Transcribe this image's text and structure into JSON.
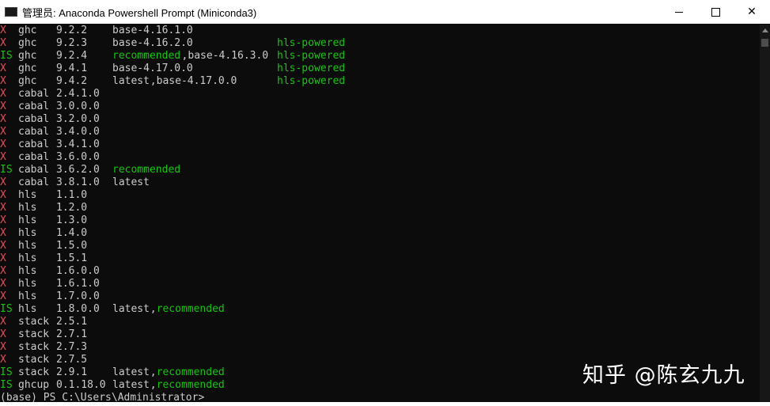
{
  "window": {
    "title": "管理员: Anaconda Powershell Prompt (Miniconda3)",
    "controls": {
      "minimize": "",
      "maximize": "",
      "close": "✕"
    }
  },
  "terminal": {
    "lines": [
      {
        "mark": "X",
        "mark_color": "red",
        "tool": "ghc",
        "version": "9.2.2",
        "tags": [
          {
            "text": "base-4.16.1.0",
            "color": "white"
          }
        ],
        "extra": ""
      },
      {
        "mark": "X",
        "mark_color": "red",
        "tool": "ghc",
        "version": "9.2.3",
        "tags": [
          {
            "text": "base-4.16.2.0",
            "color": "white"
          }
        ],
        "extra": "hls-powered"
      },
      {
        "mark": "IS",
        "mark_color": "green",
        "tool": "ghc",
        "version": "9.2.4",
        "tags": [
          {
            "text": "recommended",
            "color": "green"
          },
          {
            "text": ",",
            "color": "white"
          },
          {
            "text": "base-4.16.3.0",
            "color": "white"
          }
        ],
        "extra": "hls-powered"
      },
      {
        "mark": "X",
        "mark_color": "red",
        "tool": "ghc",
        "version": "9.4.1",
        "tags": [
          {
            "text": "base-4.17.0.0",
            "color": "white"
          }
        ],
        "extra": "hls-powered"
      },
      {
        "mark": "X",
        "mark_color": "red",
        "tool": "ghc",
        "version": "9.4.2",
        "tags": [
          {
            "text": "latest",
            "color": "white"
          },
          {
            "text": ",",
            "color": "white"
          },
          {
            "text": "base-4.17.0.0",
            "color": "white"
          }
        ],
        "extra": "hls-powered"
      },
      {
        "mark": "X",
        "mark_color": "red",
        "tool": "cabal",
        "version": "2.4.1.0",
        "tags": [],
        "extra": ""
      },
      {
        "mark": "X",
        "mark_color": "red",
        "tool": "cabal",
        "version": "3.0.0.0",
        "tags": [],
        "extra": ""
      },
      {
        "mark": "X",
        "mark_color": "red",
        "tool": "cabal",
        "version": "3.2.0.0",
        "tags": [],
        "extra": ""
      },
      {
        "mark": "X",
        "mark_color": "red",
        "tool": "cabal",
        "version": "3.4.0.0",
        "tags": [],
        "extra": ""
      },
      {
        "mark": "X",
        "mark_color": "red",
        "tool": "cabal",
        "version": "3.4.1.0",
        "tags": [],
        "extra": ""
      },
      {
        "mark": "X",
        "mark_color": "red",
        "tool": "cabal",
        "version": "3.6.0.0",
        "tags": [],
        "extra": ""
      },
      {
        "mark": "IS",
        "mark_color": "green",
        "tool": "cabal",
        "version": "3.6.2.0",
        "tags": [
          {
            "text": "recommended",
            "color": "green"
          }
        ],
        "extra": ""
      },
      {
        "mark": "X",
        "mark_color": "red",
        "tool": "cabal",
        "version": "3.8.1.0",
        "tags": [
          {
            "text": "latest",
            "color": "white"
          }
        ],
        "extra": ""
      },
      {
        "mark": "X",
        "mark_color": "red",
        "tool": "hls",
        "version": "1.1.0",
        "tags": [],
        "extra": ""
      },
      {
        "mark": "X",
        "mark_color": "red",
        "tool": "hls",
        "version": "1.2.0",
        "tags": [],
        "extra": ""
      },
      {
        "mark": "X",
        "mark_color": "red",
        "tool": "hls",
        "version": "1.3.0",
        "tags": [],
        "extra": ""
      },
      {
        "mark": "X",
        "mark_color": "red",
        "tool": "hls",
        "version": "1.4.0",
        "tags": [],
        "extra": ""
      },
      {
        "mark": "X",
        "mark_color": "red",
        "tool": "hls",
        "version": "1.5.0",
        "tags": [],
        "extra": ""
      },
      {
        "mark": "X",
        "mark_color": "red",
        "tool": "hls",
        "version": "1.5.1",
        "tags": [],
        "extra": ""
      },
      {
        "mark": "X",
        "mark_color": "red",
        "tool": "hls",
        "version": "1.6.0.0",
        "tags": [],
        "extra": ""
      },
      {
        "mark": "X",
        "mark_color": "red",
        "tool": "hls",
        "version": "1.6.1.0",
        "tags": [],
        "extra": ""
      },
      {
        "mark": "X",
        "mark_color": "red",
        "tool": "hls",
        "version": "1.7.0.0",
        "tags": [],
        "extra": ""
      },
      {
        "mark": "IS",
        "mark_color": "green",
        "tool": "hls",
        "version": "1.8.0.0",
        "tags": [
          {
            "text": "latest",
            "color": "white"
          },
          {
            "text": ",",
            "color": "white"
          },
          {
            "text": "recommended",
            "color": "green"
          }
        ],
        "extra": ""
      },
      {
        "mark": "X",
        "mark_color": "red",
        "tool": "stack",
        "version": "2.5.1",
        "tags": [],
        "extra": ""
      },
      {
        "mark": "X",
        "mark_color": "red",
        "tool": "stack",
        "version": "2.7.1",
        "tags": [],
        "extra": ""
      },
      {
        "mark": "X",
        "mark_color": "red",
        "tool": "stack",
        "version": "2.7.3",
        "tags": [],
        "extra": ""
      },
      {
        "mark": "X",
        "mark_color": "red",
        "tool": "stack",
        "version": "2.7.5",
        "tags": [],
        "extra": ""
      },
      {
        "mark": "IS",
        "mark_color": "green",
        "tool": "stack",
        "version": "2.9.1",
        "tags": [
          {
            "text": "latest",
            "color": "white"
          },
          {
            "text": ",",
            "color": "white"
          },
          {
            "text": "recommended",
            "color": "green"
          }
        ],
        "extra": ""
      },
      {
        "mark": "IS",
        "mark_color": "green",
        "tool": "ghcup",
        "version": "0.1.18.0",
        "tags": [
          {
            "text": "latest",
            "color": "white"
          },
          {
            "text": ",",
            "color": "white"
          },
          {
            "text": "recommended",
            "color": "green"
          }
        ],
        "extra": ""
      }
    ],
    "prompt": "(base) PS C:\\Users\\Administrator>"
  },
  "watermark": "知乎 @陈玄九九",
  "colors": {
    "red": "#e74856",
    "green": "#16c60c",
    "white": "#cccccc",
    "background": "#0c0c0c"
  }
}
